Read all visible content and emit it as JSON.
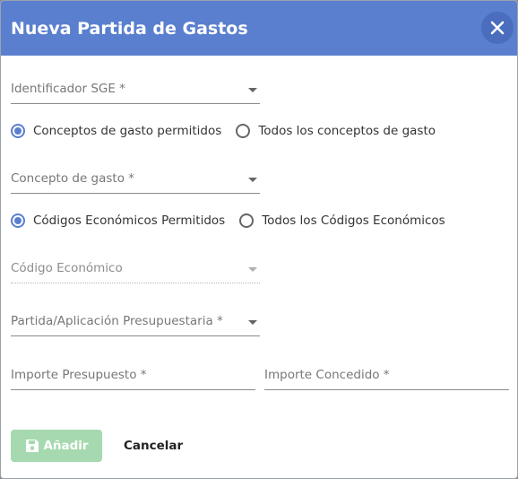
{
  "dialog": {
    "title": "Nueva Partida de Gastos",
    "close_icon": "close-icon"
  },
  "fields": {
    "identificador": {
      "label": "Identificador SGE *"
    },
    "concepto": {
      "label": "Concepto de gasto *"
    },
    "codigo": {
      "label": "Código Económico",
      "disabled": true
    },
    "partida": {
      "label": "Partida/Aplicación Presupuestaria *"
    },
    "importe_presupuesto": {
      "label": "Importe Presupuesto *"
    },
    "importe_concedido": {
      "label": "Importe Concedido *"
    }
  },
  "radios_conceptos": {
    "selected": "permitidos",
    "options": [
      {
        "label": "Conceptos de gasto permitidos"
      },
      {
        "label": "Todos los conceptos de gasto"
      }
    ]
  },
  "radios_codigos": {
    "selected": "permitidos",
    "options": [
      {
        "label": "Códigos Económicos Permitidos"
      },
      {
        "label": "Todos los Códigos Económicos"
      }
    ]
  },
  "actions": {
    "add_label": "Añadir",
    "add_icon": "save-icon",
    "add_disabled": true,
    "cancel_label": "Cancelar"
  },
  "colors": {
    "header": "#5a7fcf",
    "accent": "#5a7fcf",
    "add_button": "#a6d9af"
  }
}
